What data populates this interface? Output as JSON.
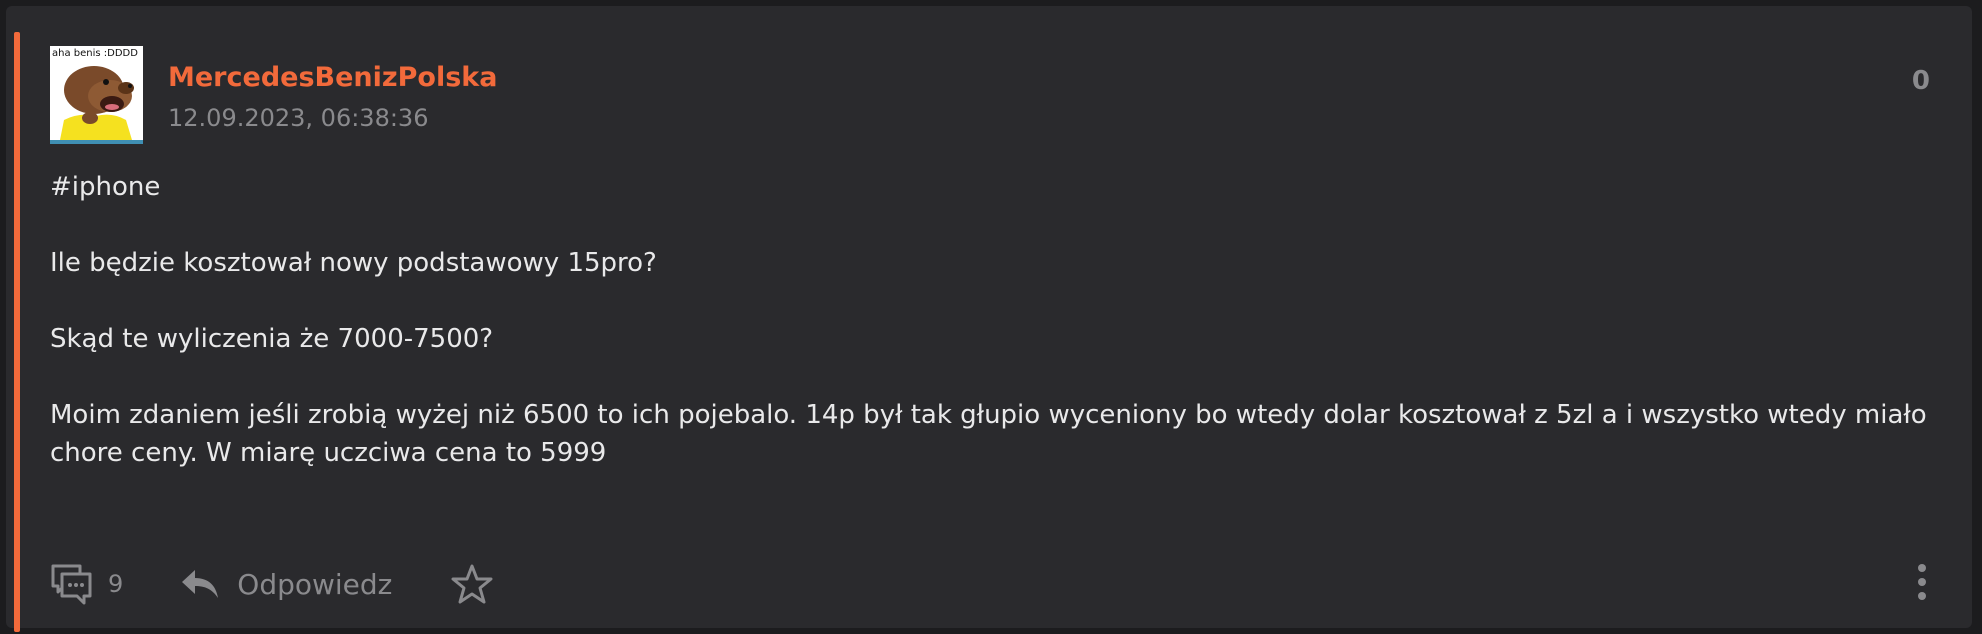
{
  "post": {
    "author": "MercedesBenizPolska",
    "timestamp": "12.09.2023, 06:38:36",
    "score": "0",
    "avatar_caption": "aha benis :DDDD",
    "paragraphs": [
      "#iphone",
      "Ile będzie kosztował nowy podstawowy 15pro?",
      "Skąd te wyliczenia że 7000-7500?",
      "Moim zdaniem jeśli zrobią wyżej niż 6500 to ich pojebalo. 14p był tak głupio wyceniony bo wtedy dolar kosztował z 5zl a i wszystko wtedy miało chore ceny. W miarę uczciwa cena to 5999"
    ]
  },
  "footer": {
    "comments_count": "9",
    "reply_label": "Odpowiedz"
  },
  "icons": {
    "comments": "comments-icon",
    "reply": "reply-arrow-icon",
    "favorite": "star-icon",
    "menu": "more-vertical-icon"
  },
  "colors": {
    "accent": "#f26a3b",
    "card_bg": "#2a2a2d",
    "muted": "#8a8a8d",
    "text": "#e9e9ea"
  }
}
